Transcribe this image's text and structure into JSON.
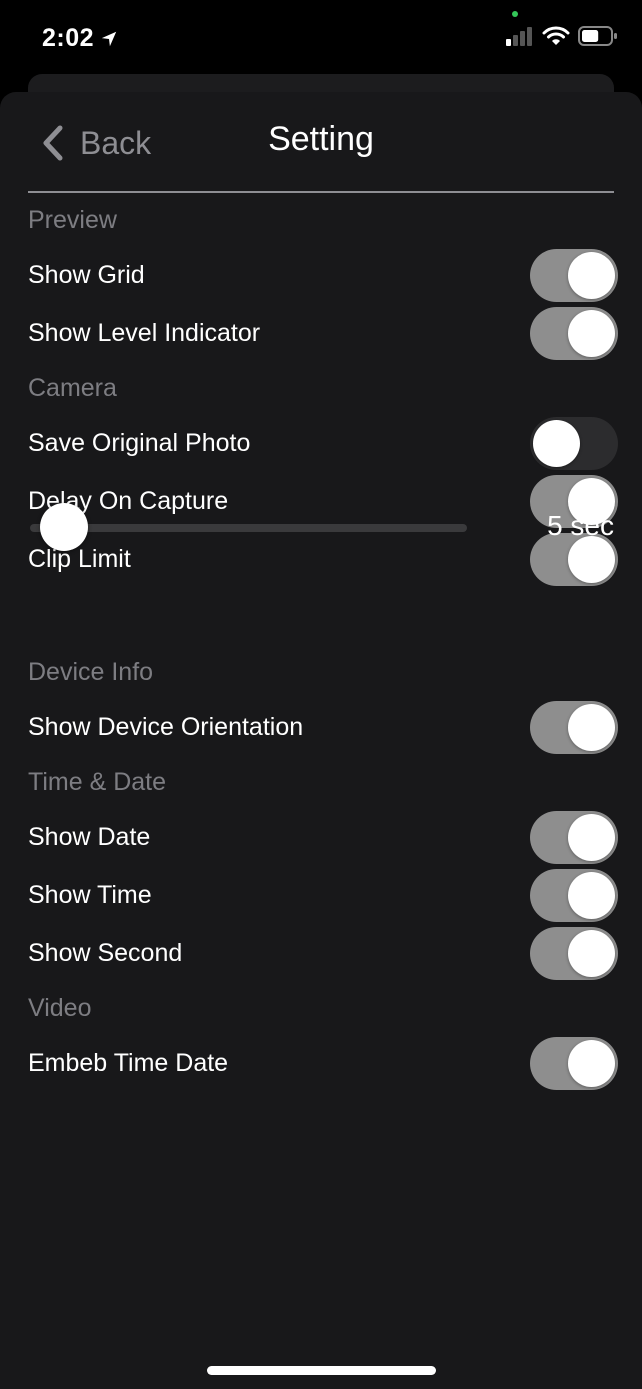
{
  "status_bar": {
    "time": "2:02",
    "location_icon": "location-arrow-icon",
    "signal_icon": "cellular-signal-icon",
    "wifi_icon": "wifi-icon",
    "battery_icon": "battery-icon",
    "battery_level": 0.6
  },
  "nav": {
    "back_label": "Back",
    "title": "Setting"
  },
  "sections": [
    {
      "header": "Preview",
      "rows": [
        {
          "label": "Show Grid",
          "on": true
        },
        {
          "label": "Show Level Indicator",
          "on": true
        }
      ]
    },
    {
      "header": "Camera",
      "rows": [
        {
          "label": "Save Original Photo",
          "on": false
        },
        {
          "label": "Delay On Capture",
          "on": true
        },
        {
          "label": "Clip Limit",
          "on": true
        }
      ],
      "slider": {
        "value_label": "5 sec",
        "fraction": 0.0
      }
    },
    {
      "header": "Device Info",
      "rows": [
        {
          "label": "Show Device Orientation",
          "on": true
        }
      ]
    },
    {
      "header": "Time & Date",
      "rows": [
        {
          "label": "Show Date",
          "on": true
        },
        {
          "label": "Show Time",
          "on": true
        },
        {
          "label": "Show Second",
          "on": true
        }
      ]
    },
    {
      "header": "Video",
      "rows": [
        {
          "label": "Embeb Time Date",
          "on": true
        }
      ]
    }
  ],
  "colors": {
    "background": "#18181a",
    "toggle_on": "#8e8e8e",
    "toggle_off": "#2c2c2e",
    "section_header": "#7d7d82"
  }
}
